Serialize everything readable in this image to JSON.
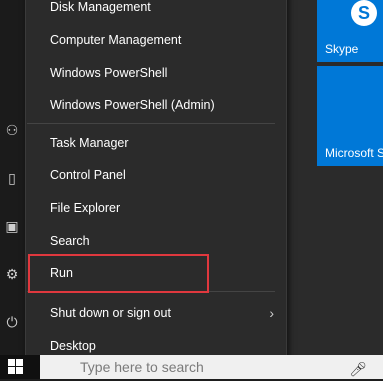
{
  "menu": {
    "items": [
      {
        "label": "Disk Management"
      },
      {
        "label": "Computer Management"
      },
      {
        "label": "Windows PowerShell"
      },
      {
        "label": "Windows PowerShell (Admin)"
      },
      {
        "label": "Task Manager"
      },
      {
        "label": "Control Panel"
      },
      {
        "label": "File Explorer"
      },
      {
        "label": "Search"
      },
      {
        "label": "Run"
      },
      {
        "label": "Shut down or sign out"
      },
      {
        "label": "Desktop"
      }
    ]
  },
  "tiles": {
    "skype": {
      "label": "Skype"
    },
    "store": {
      "label": "Microsoft S"
    }
  },
  "taskbar": {
    "search_placeholder": "Type here to search"
  },
  "colors": {
    "accent": "#0078d7",
    "highlight_border": "#e0383e",
    "menu_bg": "#2b2b2b"
  }
}
